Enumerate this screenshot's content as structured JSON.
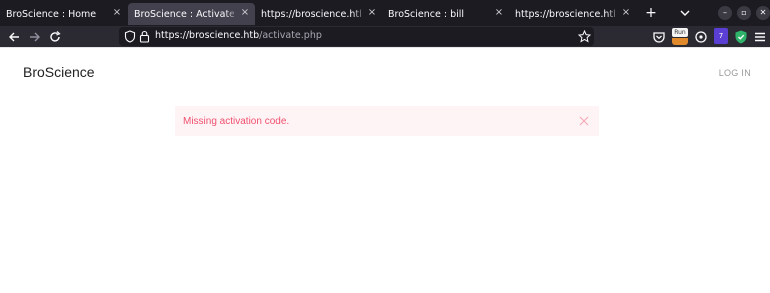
{
  "browser": {
    "tabs": [
      {
        "title": "BroScience : Home",
        "active": false
      },
      {
        "title": "BroScience : Activate account",
        "active": true
      },
      {
        "title": "https://broscience.htb/register.php",
        "active": false
      },
      {
        "title": "BroScience : bill",
        "active": false
      },
      {
        "title": "https://broscience.htb/activate.php",
        "active": false
      }
    ],
    "tab_close_glyph": "×",
    "new_tab_glyph": "+",
    "url_host": "https://broscience.htb",
    "url_path": "/activate.php",
    "extension_badge": "Run",
    "extension_badge2": "7"
  },
  "page": {
    "brand": "BroScience",
    "login_label": "LOG IN",
    "alert_text": "Missing activation code."
  },
  "colors": {
    "alert_background": "#fef4f6",
    "alert_text": "#f0506e",
    "tabstrip": "#1c1b22",
    "toolbar": "#2b2a33"
  }
}
